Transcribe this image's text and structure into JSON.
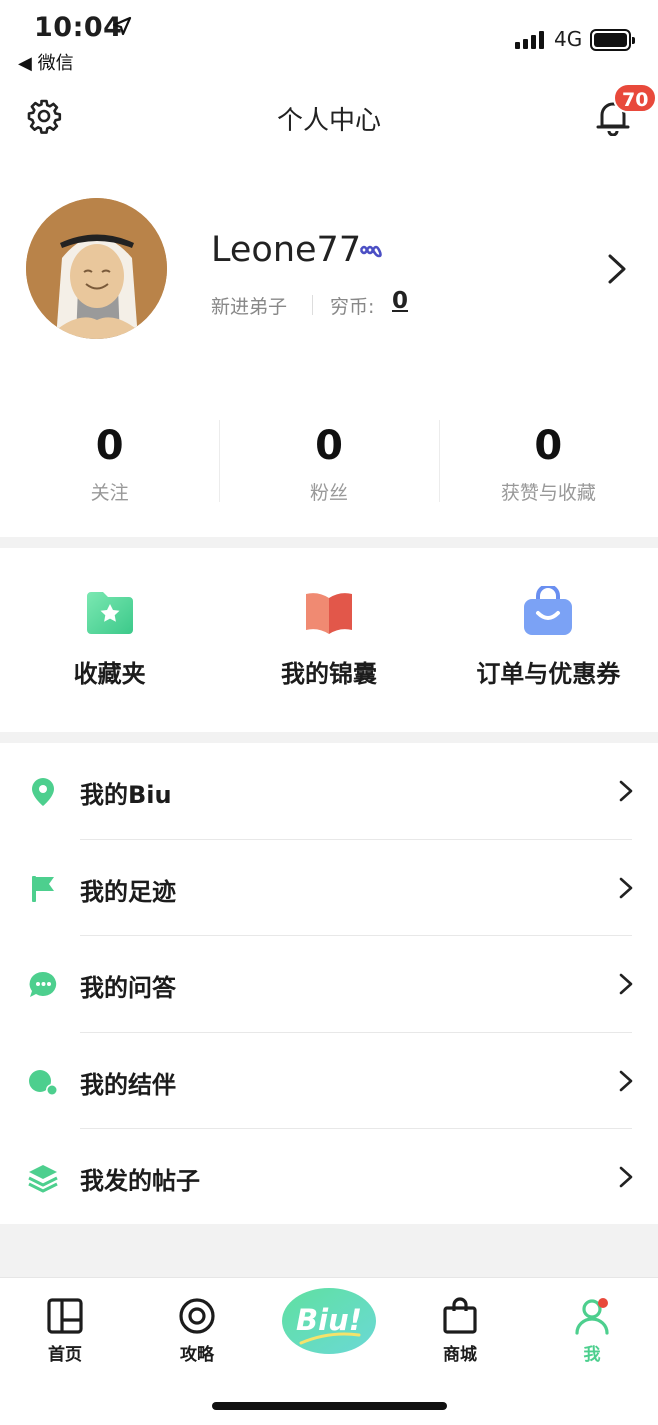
{
  "status_bar": {
    "time": "10:04",
    "back_app": "◀ 微信",
    "network": "4G"
  },
  "header": {
    "title": "个人中心",
    "notification_count": "70"
  },
  "profile": {
    "username": "Leone77",
    "level": "新进弟子",
    "coins_label": "穷币:",
    "coins_value": "0"
  },
  "stats": [
    {
      "value": "0",
      "label": "关注"
    },
    {
      "value": "0",
      "label": "粉丝"
    },
    {
      "value": "0",
      "label": "获赞与收藏"
    }
  ],
  "shortcuts": [
    {
      "label": "收藏夹",
      "icon": "folder-star-icon"
    },
    {
      "label": "我的锦囊",
      "icon": "book-icon"
    },
    {
      "label": "订单与优惠券",
      "icon": "bag-icon"
    }
  ],
  "menu": [
    {
      "label": "我的Biu",
      "icon": "location-pin-icon"
    },
    {
      "label": "我的足迹",
      "icon": "flag-icon"
    },
    {
      "label": "我的问答",
      "icon": "chat-bubble-icon"
    },
    {
      "label": "我的结伴",
      "icon": "companion-icon"
    },
    {
      "label": "我发的帖子",
      "icon": "layers-icon"
    }
  ],
  "tabbar": {
    "home": "首页",
    "guide": "攻略",
    "biu": "Biu!",
    "shop": "商城",
    "me": "我"
  },
  "colors": {
    "accent_green": "#4dcf8e",
    "badge_red": "#e8493b",
    "avatar_bg": "#b98349"
  }
}
